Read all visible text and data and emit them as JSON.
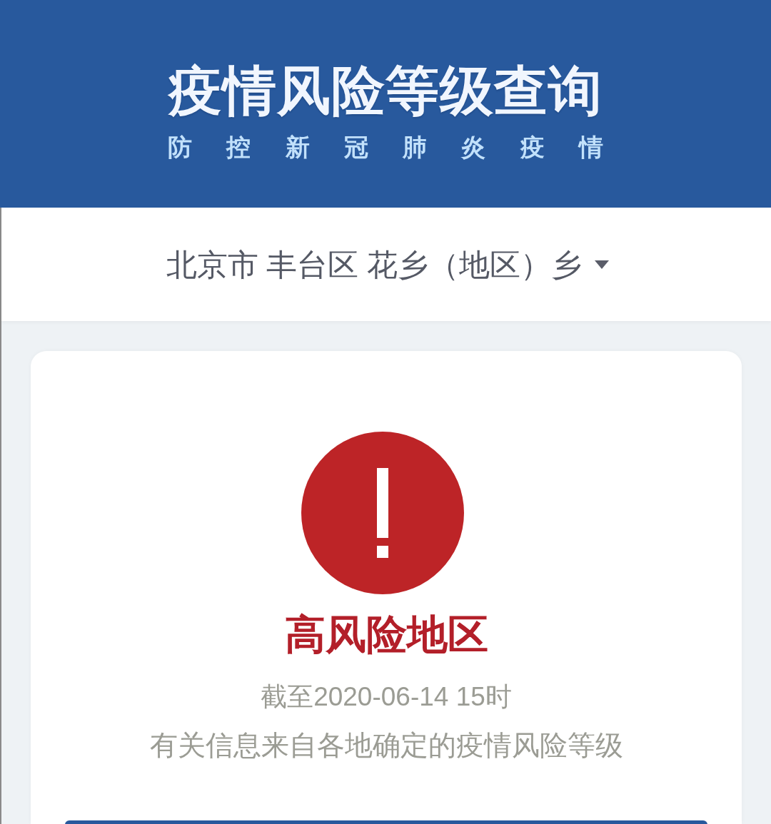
{
  "header": {
    "title": "疫情风险等级查询",
    "subtitle": "防 控 新 冠 肺 炎 疫 情"
  },
  "location_selector": {
    "text": "北京市 丰台区 花乡（地区）乡"
  },
  "result": {
    "kind": "high",
    "label": "高风险地区",
    "as_of": "截至2020-06-14 15时",
    "note": "有关信息来自各地确定的疫情风险等级"
  }
}
